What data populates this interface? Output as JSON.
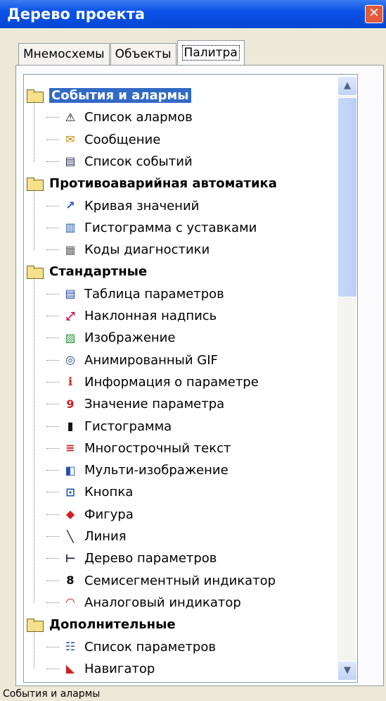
{
  "window": {
    "title": "Дерево проекта"
  },
  "tabs": [
    "Мнемосхемы",
    "Объекты",
    "Палитра"
  ],
  "active_tab": "Палитра",
  "tree": {
    "categories": [
      {
        "label": "События и алармы",
        "items": [
          "Список алармов",
          "Сообщение",
          "Список событий"
        ]
      },
      {
        "label": "Противоаварийная автоматика",
        "items": [
          "Кривая значений",
          "Гистограмма с уставками",
          "Коды диагностики"
        ]
      },
      {
        "label": "Стандартные",
        "items": [
          "Таблица параметров",
          "Наклонная надпись",
          "Изображение",
          "Анимированный GIF",
          "Информация о параметре",
          "Значение параметра",
          "Гистограмма",
          "Многострочный текст",
          "Мульти-изображение",
          "Кнопка",
          "Фигура",
          "Линия",
          "Дерево параметров",
          "Семисегментный индикатор",
          "Аналоговый индикатор"
        ]
      },
      {
        "label": "Дополнительные",
        "items": [
          "Список параметров",
          "Навигатор"
        ]
      }
    ]
  },
  "status": {
    "text": "События и алармы"
  },
  "icons": {
    "Список алармов": "alarm-warning-icon",
    "Сообщение": "message-icon",
    "Список событий": "event-list-icon",
    "Кривая значений": "value-curve-icon",
    "Гистограмма с уставками": "histogram-setpoints-icon",
    "Коды диагностики": "diagnostic-codes-icon",
    "Таблица параметров": "parameter-table-icon",
    "Наклонная надпись": "slanted-label-icon",
    "Изображение": "image-icon",
    "Анимированный GIF": "animated-gif-icon",
    "Информация о параметре": "parameter-info-icon",
    "Значение параметра": "parameter-value-icon",
    "Гистограмма": "histogram-icon",
    "Многострочный текст": "multiline-text-icon",
    "Мульти-изображение": "multi-image-icon",
    "Кнопка": "button-icon",
    "Фигура": "shape-icon",
    "Линия": "line-icon",
    "Дерево параметров": "parameter-tree-icon",
    "Семисегментный индикатор": "seven-segment-icon",
    "Аналоговый индикатор": "analog-gauge-icon",
    "Список параметров": "parameter-list-icon",
    "Навигатор": "navigator-icon"
  }
}
